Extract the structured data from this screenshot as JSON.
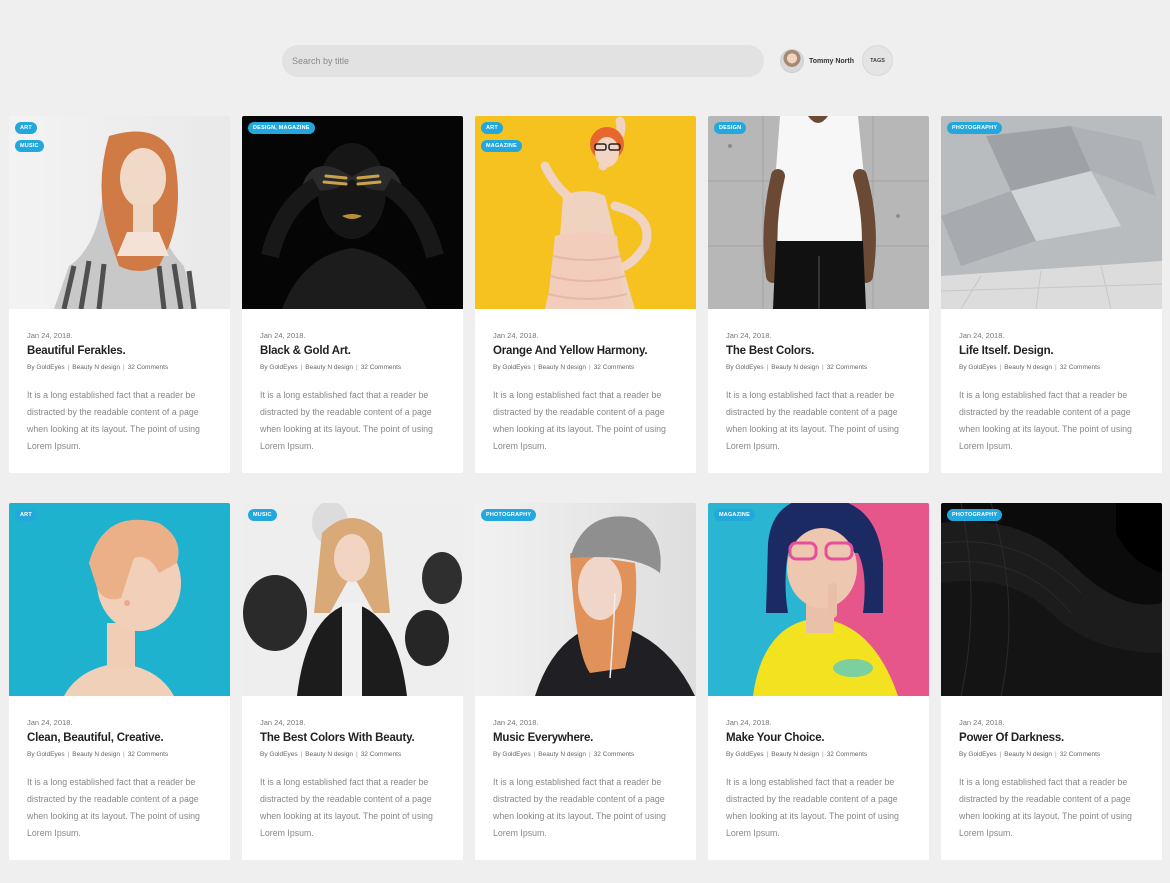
{
  "search": {
    "placeholder": "Search by title"
  },
  "user": {
    "name": "Tommy North"
  },
  "tags_label": "TAGS",
  "cards": [
    {
      "tags": [
        "ART",
        "MUSIC"
      ],
      "date": "Jan 24, 2018.",
      "title": "Beautiful Ferakles.",
      "author": "By GoldEyes",
      "category": "Beauty N design",
      "comments": "32 Comments",
      "excerpt": "It is a long established fact that a reader be distracted by the readable content of a page when looking at its layout. The point of using Lorem Ipsum."
    },
    {
      "tags": [
        "DESIGN, MAGAZINE"
      ],
      "date": "Jan 24, 2018.",
      "title": "Black & Gold Art.",
      "author": "By GoldEyes",
      "category": "Beauty N design",
      "comments": "32 Comments",
      "excerpt": "It is a long established fact that a reader be distracted by the readable content of a page when looking at its layout. The point of using Lorem Ipsum."
    },
    {
      "tags": [
        "ART",
        "MAGAZINE"
      ],
      "date": "Jan 24, 2018.",
      "title": "Orange And Yellow Harmony.",
      "author": "By GoldEyes",
      "category": "Beauty N design",
      "comments": "32 Comments",
      "excerpt": "It is a long established fact that a reader be distracted by the readable content of a page when looking at its layout. The point of using Lorem Ipsum."
    },
    {
      "tags": [
        "DESIGN"
      ],
      "date": "Jan 24, 2018.",
      "title": "The Best Colors.",
      "author": "By GoldEyes",
      "category": "Beauty N design",
      "comments": "32 Comments",
      "excerpt": "It is a long established fact that a reader be distracted by the readable content of a page when looking at its layout. The point of using Lorem Ipsum."
    },
    {
      "tags": [
        "PHOTOGRAPHY"
      ],
      "date": "Jan 24, 2018.",
      "title": "Life Itself. Design.",
      "author": "By GoldEyes",
      "category": "Beauty N design",
      "comments": "32 Comments",
      "excerpt": "It is a long established fact that a reader be distracted by the readable content of a page when looking at its layout. The point of using Lorem Ipsum."
    },
    {
      "tags": [
        "ART"
      ],
      "date": "Jan 24, 2018.",
      "title": "Clean, Beautiful, Creative.",
      "author": "By GoldEyes",
      "category": "Beauty N design",
      "comments": "32 Comments",
      "excerpt": "It is a long established fact that a reader be distracted by the readable content of a page when looking at its layout. The point of using Lorem Ipsum."
    },
    {
      "tags": [
        "MUSIC"
      ],
      "date": "Jan 24, 2018.",
      "title": "The Best Colors With Beauty.",
      "author": "By GoldEyes",
      "category": "Beauty N design",
      "comments": "32 Comments",
      "excerpt": "It is a long established fact that a reader be distracted by the readable content of a page when looking at its layout. The point of using Lorem Ipsum."
    },
    {
      "tags": [
        "PHOTOGRAPHY"
      ],
      "date": "Jan 24, 2018.",
      "title": "Music Everywhere.",
      "author": "By GoldEyes",
      "category": "Beauty N design",
      "comments": "32 Comments",
      "excerpt": "It is a long established fact that a reader be distracted by the readable content of a page when looking at its layout. The point of using Lorem Ipsum."
    },
    {
      "tags": [
        "MAGAZINE"
      ],
      "date": "Jan 24, 2018.",
      "title": "Make Your Choice.",
      "author": "By GoldEyes",
      "category": "Beauty N design",
      "comments": "32 Comments",
      "excerpt": "It is a long established fact that a reader be distracted by the readable content of a page when looking at its layout. The point of using Lorem Ipsum."
    },
    {
      "tags": [
        "PHOTOGRAPHY"
      ],
      "date": "Jan 24, 2018.",
      "title": "Power Of Darkness.",
      "author": "By GoldEyes",
      "category": "Beauty N design",
      "comments": "32 Comments",
      "excerpt": "It is a long established fact that a reader be distracted by the readable content of a page when looking at its layout. The point of using Lorem Ipsum."
    }
  ],
  "colors": {
    "accent": "#22a8dc",
    "page_background": "#efefef",
    "card_background": "#ffffff"
  }
}
